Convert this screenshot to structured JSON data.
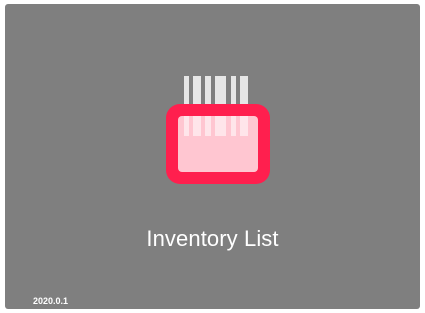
{
  "splash": {
    "title": "Inventory List",
    "version": "2020.0.1",
    "icon": "barcode-scanner-icon"
  },
  "colors": {
    "background": "#7f7f7f",
    "accent": "#ff1f4e",
    "barcode": "#e6e6e6",
    "window": "#ffc6d1",
    "text": "#ffffff"
  }
}
